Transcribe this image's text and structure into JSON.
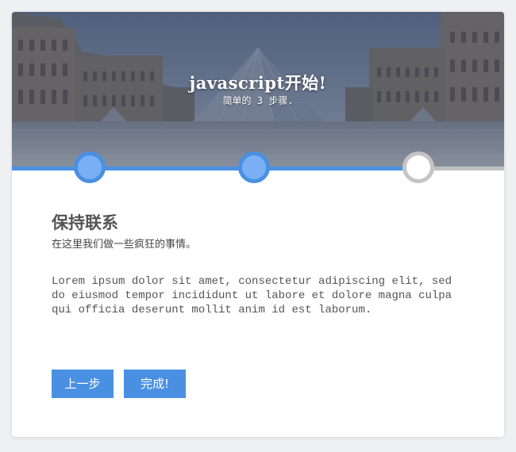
{
  "hero": {
    "title": "javascript开始!",
    "subtitle": "简单的 3 步骤."
  },
  "steps": [
    {
      "state": "completed"
    },
    {
      "state": "completed"
    },
    {
      "state": "current"
    }
  ],
  "colors": {
    "accent": "#4a90e2",
    "step_fill": "#79b0f5",
    "inactive": "#c4c4c4",
    "card_bg": "#ffffff",
    "page_bg": "#eef0f2"
  },
  "form": {
    "title": "保持联系",
    "subtitle": "在这里我们做一些疯狂的事情。",
    "body": "Lorem ipsum dolor sit amet, consectetur adipiscing elit, sed do eiusmod tempor incididunt ut labore et dolore magna culpa qui officia deserunt mollit anim id est laborum."
  },
  "buttons": {
    "prev_label": "上一步",
    "finish_label": "完成!"
  }
}
